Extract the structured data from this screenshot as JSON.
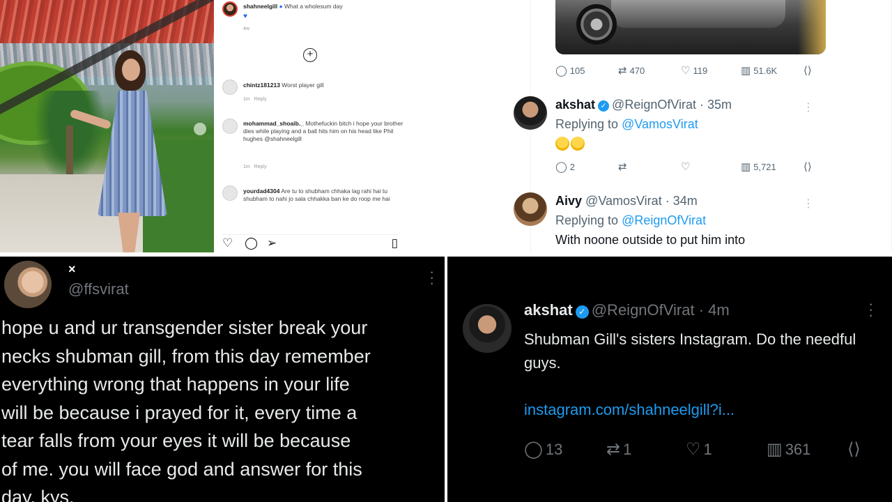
{
  "instagram": {
    "caption_user": "shahneelgill",
    "caption_text": "What a wholesum day",
    "caption_time": "4w",
    "comments": [
      {
        "user": "chintz181213",
        "text": "Worst player gill",
        "time": "1m",
        "reply": "Reply"
      },
      {
        "user": "mohammad_shoaib._",
        "text": "Mothefuckin bitch i hope your brother dies while playing and a ball hits him on his head like Phil hughes @shahneelgill",
        "time": "1m",
        "reply": "Reply"
      },
      {
        "user": "yourdad4304",
        "text": "Are tu to shubham chhaka lag rahi hai tu shubham to nahi jo sala chhakka ban ke do roop me hai",
        "time": "",
        "reply": ""
      }
    ],
    "icons": [
      "heart-outline-icon",
      "comment-icon",
      "share-icon",
      "bookmark-icon"
    ]
  },
  "twitter_light": {
    "top_stats": {
      "replies": "105",
      "retweets": "470",
      "likes": "119",
      "views": "51.6K"
    },
    "post1": {
      "name": "akshat",
      "handle": "@ReignOfVirat · 35m",
      "replying_prefix": "Replying to",
      "replying_to": "@VamosVirat",
      "body_emoji": "😢😢",
      "stats": {
        "replies": "2",
        "retweets": "",
        "likes": "",
        "views": "5,721"
      }
    },
    "post2": {
      "name": "Aivy",
      "handle": "@VamosVirat · 34m",
      "replying_prefix": "Replying to",
      "replying_to": "@ReignOfVirat",
      "body": "With noone outside to put him into"
    }
  },
  "dark_tweet_left": {
    "close_label": "×",
    "handle": "@ffsvirat",
    "text": "hope u and ur transgender sister break your\nnecks shubman gill, from this day remember\neverything wrong that happens in your life\nwill be because i prayed for it, every time a\ntear falls from your eyes it will be because\nof me. you will face god and answer for this\nday. kys."
  },
  "dark_tweet_right": {
    "name": "akshat",
    "handle": "@ReignOfVirat · 4m",
    "text": "Shubman Gill's sisters Instagram. Do the needful guys.",
    "link": "instagram.com/shahneelgill?i...",
    "stats": {
      "replies": "13",
      "retweets": "1",
      "likes": "1",
      "views": "361"
    }
  },
  "colors": {
    "twitter_blue": "#1d9bf0",
    "dark_bg": "#000000",
    "muted": "#71767b"
  }
}
